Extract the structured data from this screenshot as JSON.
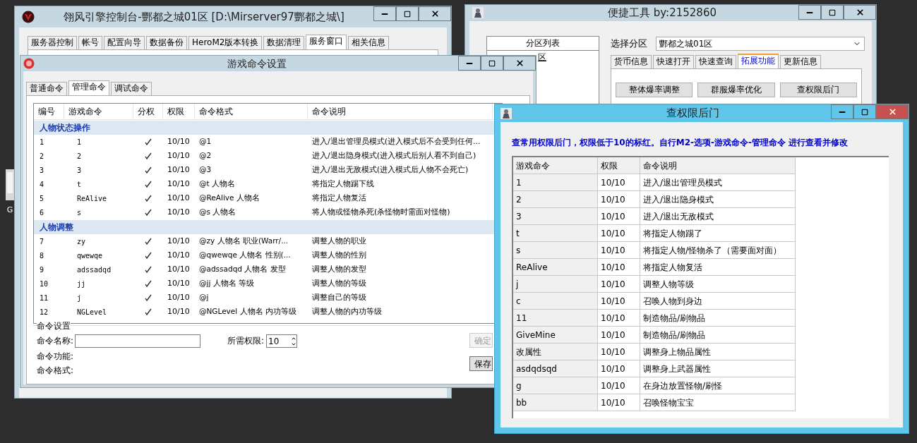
{
  "desktop_icon": {
    "label": "G"
  },
  "console_window": {
    "title": "翎风引擎控制台-酆都之城01区 [D:\\Mirserver97酆都之城\\]",
    "tabs": [
      {
        "label": "服务器控制",
        "selected": false
      },
      {
        "label": "帐号",
        "selected": false
      },
      {
        "label": "配置向导",
        "selected": false
      },
      {
        "label": "数据备份",
        "selected": false
      },
      {
        "label": "HeroM2版本转换",
        "selected": false
      },
      {
        "label": "数据清理",
        "selected": false
      },
      {
        "label": "服务窗口",
        "selected": true
      },
      {
        "label": "相关信息",
        "selected": false
      }
    ]
  },
  "tool_window": {
    "title": "便捷工具 by:2152860",
    "list_header": "分区列表",
    "list_items": [
      "区"
    ],
    "zone_label": "选择分区",
    "zone_value": "酆都之城01区",
    "tabs": [
      {
        "label": "货币信息",
        "selected": false
      },
      {
        "label": "快速打开",
        "selected": false
      },
      {
        "label": "快速查询",
        "selected": false
      },
      {
        "label": "拓展功能",
        "selected": true
      },
      {
        "label": "更新信息",
        "selected": false
      }
    ],
    "buttons": [
      "整体爆率调整",
      "群服爆率优化",
      "查权限后门"
    ]
  },
  "command_window": {
    "title": "游戏命令设置",
    "tabs": [
      {
        "label": "普通命令",
        "selected": false
      },
      {
        "label": "管理命令",
        "selected": true
      },
      {
        "label": "调试命令",
        "selected": false
      }
    ],
    "table": {
      "columns": [
        "编号",
        "游戏命令",
        "分权",
        "权限",
        "命令格式",
        "命令说明"
      ],
      "groups": [
        {
          "name": "人物状态操作",
          "rows": [
            {
              "no": "1",
              "command": "1",
              "authorized": true,
              "level": "10/10",
              "format": "@1",
              "description": "进入/退出管理员模式(进入模式后不会受到任何..."
            },
            {
              "no": "2",
              "command": "2",
              "authorized": true,
              "level": "10/10",
              "format": "@2",
              "description": "进入/退出隐身模式(进入模式后别人看不到自己)"
            },
            {
              "no": "3",
              "command": "3",
              "authorized": true,
              "level": "10/10",
              "format": "@3",
              "description": "进入/退出无敌模式(进入模式后人物不会死亡)"
            },
            {
              "no": "4",
              "command": "t",
              "authorized": true,
              "level": "10/10",
              "format": "@t 人物名",
              "description": "将指定人物踢下线"
            },
            {
              "no": "5",
              "command": "ReAlive",
              "authorized": true,
              "level": "10/10",
              "format": "@ReAlive 人物名",
              "description": "将指定人物复活"
            },
            {
              "no": "6",
              "command": "s",
              "authorized": true,
              "level": "10/10",
              "format": "@s 人物名",
              "description": "将人物或怪物杀死(杀怪物时需面对怪物)"
            }
          ]
        },
        {
          "name": "人物调整",
          "rows": [
            {
              "no": "7",
              "command": "zy",
              "authorized": true,
              "level": "10/10",
              "format": "@zy 人物名 职业(Warr/...",
              "description": "调整人物的职业"
            },
            {
              "no": "8",
              "command": "qwewqe",
              "authorized": true,
              "level": "10/10",
              "format": "@qwewqe 人物名 性别(...",
              "description": "调整人物的性别"
            },
            {
              "no": "9",
              "command": "adssadqd",
              "authorized": true,
              "level": "10/10",
              "format": "@adssadqd 人物名 发型",
              "description": "调整人物的发型"
            },
            {
              "no": "10",
              "command": "jj",
              "authorized": true,
              "level": "10/10",
              "format": "@jj 人物名 等级",
              "description": "调整人物的等级"
            },
            {
              "no": "11",
              "command": "j",
              "authorized": true,
              "level": "10/10",
              "format": "@j",
              "description": "调整自己的等级"
            },
            {
              "no": "12",
              "command": "NGLevel",
              "authorized": true,
              "level": "10/10",
              "format": "@NGLevel 人物名 内功等级",
              "description": "调整人物的内功等级"
            }
          ]
        }
      ]
    },
    "settings": {
      "title": "命令设置",
      "name_label": "命令名称:",
      "level_label": "所需权限:",
      "level_value": "10",
      "function_label": "命令功能:",
      "format_label": "命令格式:",
      "buttons": [
        {
          "label": "确定",
          "disabled": true
        },
        {
          "label": "保存",
          "disabled": false
        }
      ]
    }
  },
  "backdoor_window": {
    "title": "查权限后门",
    "notice": "查常用权限后门，权限低于10的标红。自行M2-选项-游戏命令-管理命令  进行查看并修改",
    "columns": [
      "游戏命令",
      "权限",
      "命令说明"
    ],
    "rows": [
      {
        "command": "1",
        "level": "10/10",
        "description": "进入/退出管理员模式",
        "low": false
      },
      {
        "command": "2",
        "level": "10/10",
        "description": "进入/退出隐身模式",
        "low": false
      },
      {
        "command": "3",
        "level": "10/10",
        "description": "进入/退出无敌模式",
        "low": false
      },
      {
        "command": "t",
        "level": "10/10",
        "description": "将指定人物踢了",
        "low": false
      },
      {
        "command": "s",
        "level": "10/10",
        "description": "将指定人物/怪物杀了（需要面对面）",
        "low": false
      },
      {
        "command": "ReAlive",
        "level": "10/10",
        "description": "将指定人物复活",
        "low": false
      },
      {
        "command": "j",
        "level": "10/10",
        "description": "调整人物等级",
        "low": false
      },
      {
        "command": "c",
        "level": "10/10",
        "description": "召唤人物到身边",
        "low": false
      },
      {
        "command": "11",
        "level": "10/10",
        "description": "制造物品/刷物品",
        "low": false
      },
      {
        "command": "GiveMine",
        "level": "10/10",
        "description": "制造物品/刷物品",
        "low": false
      },
      {
        "command": "改属性",
        "level": "10/10",
        "description": "调整身上物品属性",
        "low": false
      },
      {
        "command": "asdqdsqd",
        "level": "10/10",
        "description": "调整身上武器属性",
        "low": false
      },
      {
        "command": "g",
        "level": "10/10",
        "description": "在身边放置怪物/刷怪",
        "low": false
      },
      {
        "command": "bb",
        "level": "10/10",
        "description": "召唤怪物宝宝",
        "low": false
      }
    ]
  }
}
